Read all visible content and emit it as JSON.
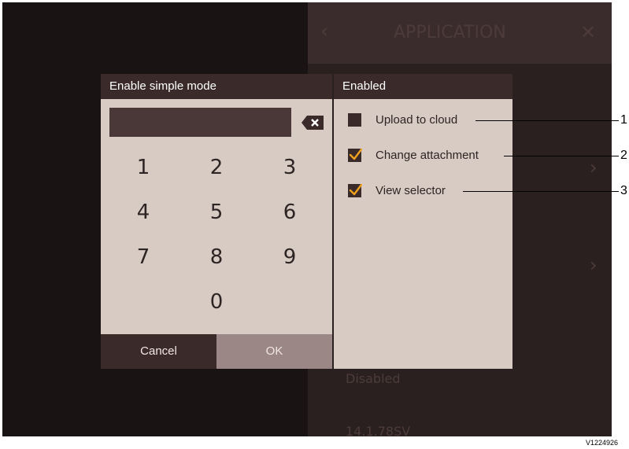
{
  "background": {
    "title": "APPLICATION",
    "items": [
      "Disabled",
      "14.1.78SV"
    ]
  },
  "keypad_dialog": {
    "title": "Enable simple mode",
    "pin_value": "",
    "keys": [
      "1",
      "2",
      "3",
      "4",
      "5",
      "6",
      "7",
      "8",
      "9",
      "0"
    ],
    "cancel_label": "Cancel",
    "ok_label": "OK"
  },
  "options_panel": {
    "title": "Enabled",
    "options": [
      {
        "label": "Upload to cloud",
        "checked": false
      },
      {
        "label": "Change attachment",
        "checked": true
      },
      {
        "label": "View selector",
        "checked": true
      }
    ]
  },
  "callouts": [
    "1",
    "2",
    "3"
  ],
  "figure_code": "V1224926",
  "colors": {
    "dialog_bg": "#d8cbc3",
    "title_bar": "#3a2a2a",
    "ok_button": "#9b8786",
    "check_accent": "#f0a21e",
    "screen_bg": "#1c1615"
  }
}
